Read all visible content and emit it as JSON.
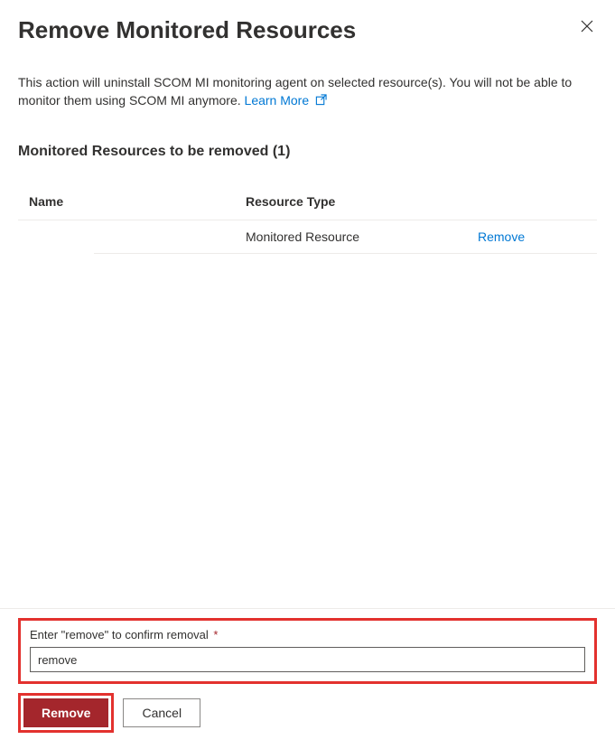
{
  "panel": {
    "title": "Remove Monitored Resources",
    "description": "This action will uninstall SCOM MI monitoring agent on selected resource(s). You will not be able to monitor them using SCOM MI anymore. ",
    "learnMore": "Learn More"
  },
  "list": {
    "heading": "Monitored Resources to be removed (1)",
    "columns": {
      "name": "Name",
      "type": "Resource Type"
    },
    "rows": [
      {
        "name": "",
        "type": "Monitored Resource",
        "action": "Remove"
      }
    ]
  },
  "confirm": {
    "label": "Enter \"remove\" to confirm removal",
    "required": "*",
    "value": "remove"
  },
  "buttons": {
    "primary": "Remove",
    "secondary": "Cancel"
  }
}
